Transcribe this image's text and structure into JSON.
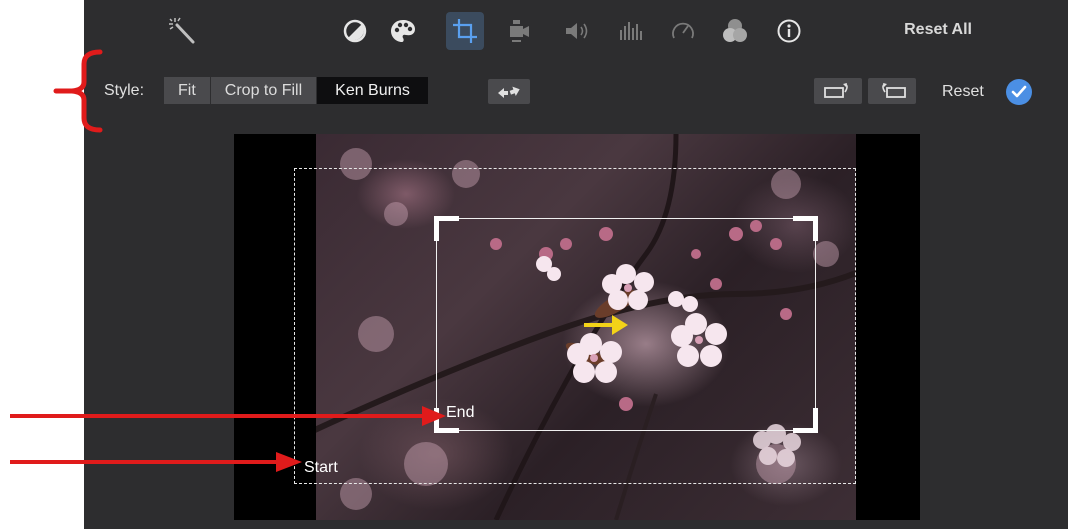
{
  "toolbar": {
    "icons": [
      {
        "name": "magic-wand-icon",
        "active": false
      },
      {
        "name": "color-balance-icon",
        "active": false
      },
      {
        "name": "palette-icon",
        "active": false
      },
      {
        "name": "crop-icon",
        "active": true
      },
      {
        "name": "video-camera-icon",
        "active": false
      },
      {
        "name": "volume-icon",
        "active": false
      },
      {
        "name": "equalizer-icon",
        "active": false
      },
      {
        "name": "speed-gauge-icon",
        "active": false
      },
      {
        "name": "filters-icon",
        "active": false
      },
      {
        "name": "info-icon",
        "active": false
      }
    ],
    "reset_all_label": "Reset All"
  },
  "style_row": {
    "label": "Style:",
    "options": [
      "Fit",
      "Crop to Fill",
      "Ken Burns"
    ],
    "selected": "Ken Burns",
    "swap_icon": "swap-start-end-icon",
    "rotate_left_icon": "rotate-left-icon",
    "rotate_right_icon": "rotate-right-icon",
    "reset_label": "Reset",
    "apply_icon": "checkmark-icon"
  },
  "viewer": {
    "end_label": "End",
    "start_label": "Start",
    "motion_arrow_color": "#f3d318"
  },
  "colors": {
    "panel_bg": "#2d2d2f",
    "accent_blue": "#4b8fe4",
    "annotation_red": "#e01b1b"
  }
}
